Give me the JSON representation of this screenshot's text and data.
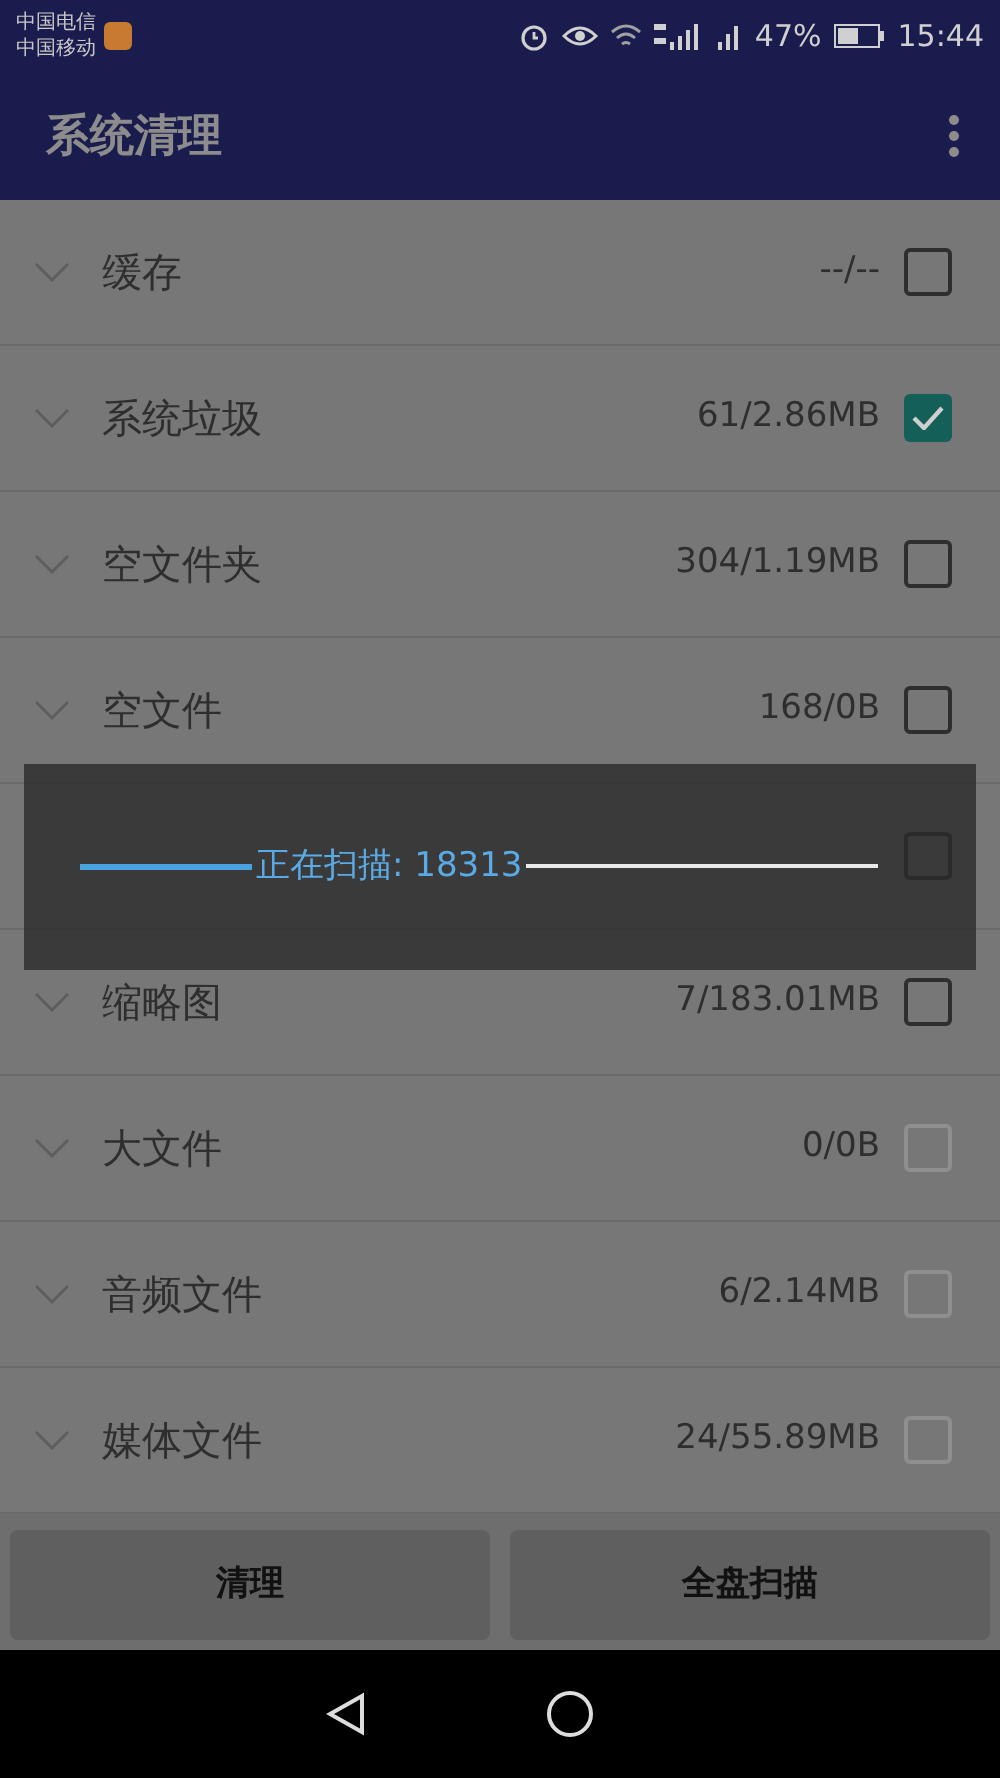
{
  "status_bar": {
    "carriers": [
      "中国电信",
      "中国移动"
    ],
    "battery": "47%",
    "time": "15:44"
  },
  "app_bar": {
    "title": "系统清理"
  },
  "items": [
    {
      "name": "缓存",
      "summary": "--/--",
      "checked": false,
      "disabled": false
    },
    {
      "name": "系统垃圾",
      "summary": "61/2.86MB",
      "checked": true,
      "disabled": false
    },
    {
      "name": "空文件夹",
      "summary": "304/1.19MB",
      "checked": false,
      "disabled": false
    },
    {
      "name": "空文件",
      "summary": "168/0B",
      "checked": false,
      "disabled": false
    },
    {
      "checked": false,
      "disabled": false
    },
    {
      "name": "缩略图",
      "summary": "7/183.01MB",
      "checked": false,
      "disabled": false
    },
    {
      "name": "大文件",
      "summary": "0/0B",
      "checked": false,
      "disabled": true
    },
    {
      "name": "音频文件",
      "summary": "6/2.14MB",
      "checked": false,
      "disabled": true
    },
    {
      "name": "媒体文件",
      "summary": "24/55.89MB",
      "checked": false,
      "disabled": true
    }
  ],
  "progress_dialog": {
    "message": "正在扫描: 18313"
  },
  "buttons": [
    "清理",
    "全盘扫描"
  ]
}
